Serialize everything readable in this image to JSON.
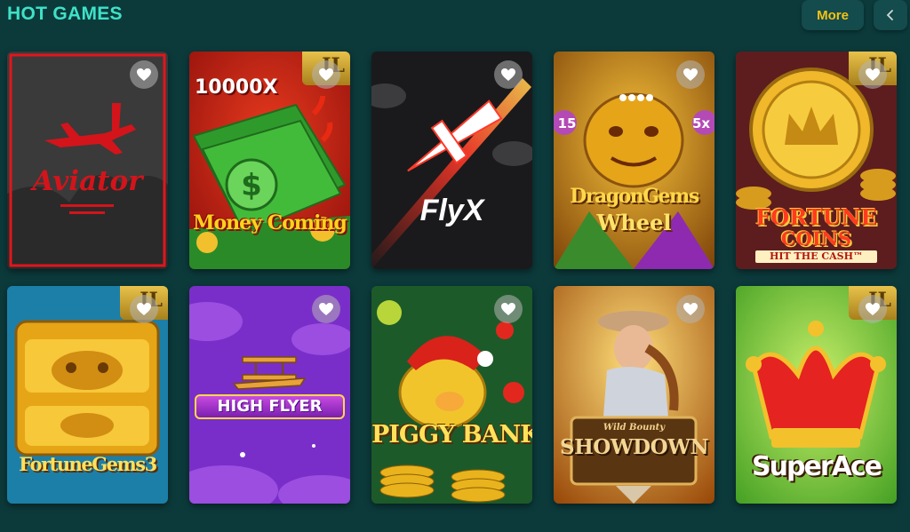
{
  "section": {
    "title": "HOT GAMES",
    "more_label": "More",
    "prev_icon": "chevron-left-icon"
  },
  "games": [
    {
      "title": "Aviator",
      "badge": "",
      "icon": "heart-icon"
    },
    {
      "title": "Money Coming",
      "multiplier": "10000X",
      "badge": "IL",
      "icon": "heart-icon"
    },
    {
      "title": "FlyX",
      "badge": "",
      "icon": "heart-icon"
    },
    {
      "title_line1": "DragonGems",
      "title_line2": "Wheel",
      "left_tag": "15",
      "right_tag": "5x",
      "badge": "",
      "icon": "heart-icon"
    },
    {
      "title_line1": "FORTUNE",
      "title_line2": "COINS",
      "subtitle": "HIT THE CASH™",
      "badge": "IL",
      "icon": "heart-icon"
    },
    {
      "title": "FortuneGems3",
      "badge": "IL",
      "icon": "heart-icon"
    },
    {
      "title": "HIGH FLYER",
      "badge": "",
      "icon": "heart-icon"
    },
    {
      "title": "PIGGY BANK",
      "badge": "",
      "icon": "heart-icon"
    },
    {
      "title_small": "Wild Bounty",
      "title": "SHOWDOWN",
      "badge": "",
      "icon": "heart-icon"
    },
    {
      "title": "SuperAce",
      "badge": "IL",
      "icon": "heart-icon"
    }
  ],
  "colors": {
    "background": "#0c3a3b",
    "title": "#3ee2c8",
    "more_text": "#f2c315",
    "button_bg": "#144b4c"
  }
}
